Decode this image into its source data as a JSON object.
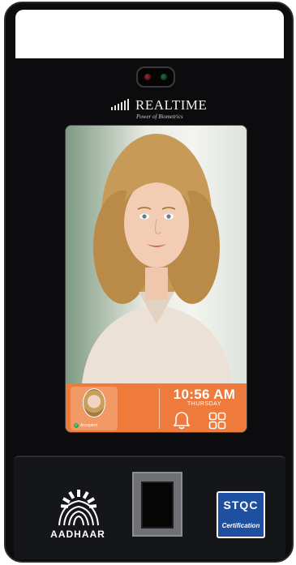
{
  "brand": {
    "name": "REALTIME",
    "tagline": "Power of Biometrics"
  },
  "screen": {
    "time": "10:56 AM",
    "day": "THURSDAY",
    "status_label": "Accepted"
  },
  "badges": {
    "aadhaar": "AADHAAR",
    "stqc_top": "STQC",
    "stqc_bottom": "Certification"
  },
  "colors": {
    "accent": "#ee7a3c",
    "device_body": "#0c0c0e",
    "stqc_blue": "#1f4fa0"
  }
}
